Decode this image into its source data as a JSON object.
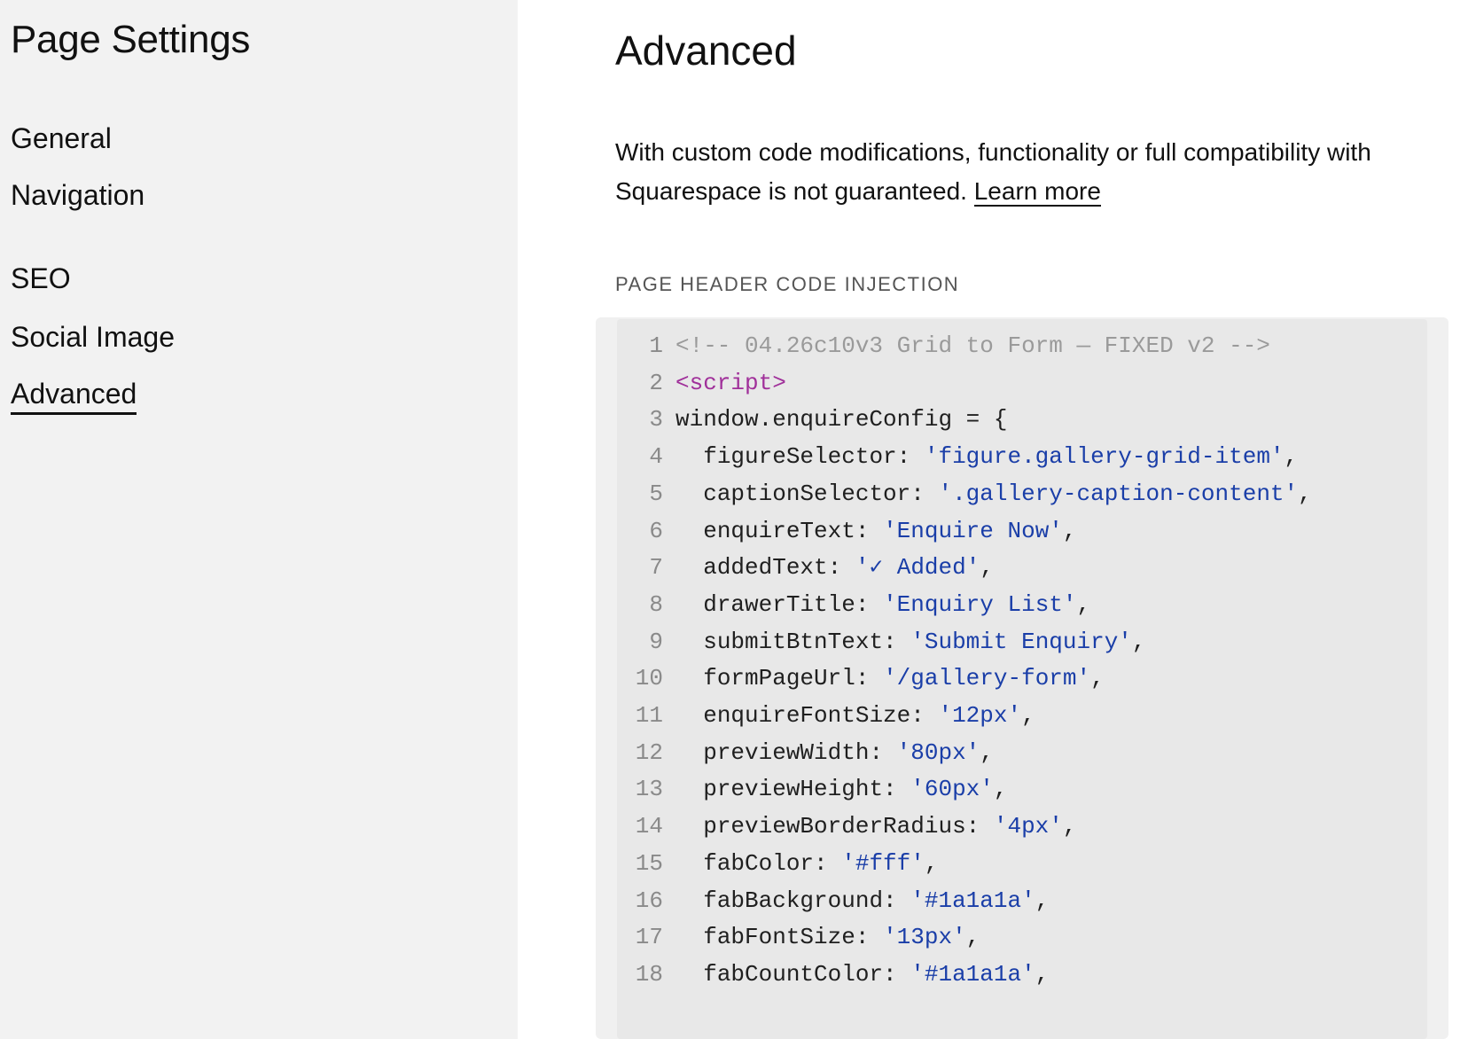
{
  "sidebar": {
    "title": "Page Settings",
    "items": [
      {
        "label": "General",
        "active": false
      },
      {
        "label": "Navigation",
        "active": false
      },
      {
        "label": "SEO",
        "active": false
      },
      {
        "label": "Social Image",
        "active": false
      },
      {
        "label": "Advanced",
        "active": true
      }
    ]
  },
  "main": {
    "title": "Advanced",
    "notice_text": "With custom code modifications, functionality or full compatibility with Squarespace is not guaranteed.",
    "learn_more_label": "Learn more",
    "section_label": "PAGE HEADER CODE INJECTION",
    "code_lines": [
      {
        "n": "1",
        "indent": "",
        "parts": [
          {
            "t": "comment",
            "v": "<!-- 04.26c10v3 Grid to Form — FIXED v2 -->"
          }
        ]
      },
      {
        "n": "2",
        "indent": "",
        "parts": [
          {
            "t": "tag",
            "v": "<script>"
          }
        ]
      },
      {
        "n": "3",
        "indent": "",
        "parts": [
          {
            "t": "plain",
            "v": "window.enquireConfig = {"
          }
        ]
      },
      {
        "n": "4",
        "indent": "  ",
        "parts": [
          {
            "t": "plain",
            "v": "figureSelector: "
          },
          {
            "t": "str",
            "v": "'figure.gallery-grid-item'"
          },
          {
            "t": "plain",
            "v": ","
          }
        ]
      },
      {
        "n": "5",
        "indent": "  ",
        "parts": [
          {
            "t": "plain",
            "v": "captionSelector: "
          },
          {
            "t": "str",
            "v": "'.gallery-caption-content'"
          },
          {
            "t": "plain",
            "v": ","
          }
        ]
      },
      {
        "n": "6",
        "indent": "  ",
        "parts": [
          {
            "t": "plain",
            "v": "enquireText: "
          },
          {
            "t": "str",
            "v": "'Enquire Now'"
          },
          {
            "t": "plain",
            "v": ","
          }
        ]
      },
      {
        "n": "7",
        "indent": "  ",
        "parts": [
          {
            "t": "plain",
            "v": "addedText: "
          },
          {
            "t": "str",
            "v": "'✓ Added'"
          },
          {
            "t": "plain",
            "v": ","
          }
        ]
      },
      {
        "n": "8",
        "indent": "  ",
        "parts": [
          {
            "t": "plain",
            "v": "drawerTitle: "
          },
          {
            "t": "str",
            "v": "'Enquiry List'"
          },
          {
            "t": "plain",
            "v": ","
          }
        ]
      },
      {
        "n": "9",
        "indent": "  ",
        "parts": [
          {
            "t": "plain",
            "v": "submitBtnText: "
          },
          {
            "t": "str",
            "v": "'Submit Enquiry'"
          },
          {
            "t": "plain",
            "v": ","
          }
        ]
      },
      {
        "n": "10",
        "indent": "  ",
        "parts": [
          {
            "t": "plain",
            "v": "formPageUrl: "
          },
          {
            "t": "str",
            "v": "'/gallery-form'"
          },
          {
            "t": "plain",
            "v": ","
          }
        ]
      },
      {
        "n": "11",
        "indent": "  ",
        "parts": [
          {
            "t": "plain",
            "v": "enquireFontSize: "
          },
          {
            "t": "str",
            "v": "'12px'"
          },
          {
            "t": "plain",
            "v": ","
          }
        ]
      },
      {
        "n": "12",
        "indent": "  ",
        "parts": [
          {
            "t": "plain",
            "v": "previewWidth: "
          },
          {
            "t": "str",
            "v": "'80px'"
          },
          {
            "t": "plain",
            "v": ","
          }
        ]
      },
      {
        "n": "13",
        "indent": "  ",
        "parts": [
          {
            "t": "plain",
            "v": "previewHeight: "
          },
          {
            "t": "str",
            "v": "'60px'"
          },
          {
            "t": "plain",
            "v": ","
          }
        ]
      },
      {
        "n": "14",
        "indent": "  ",
        "parts": [
          {
            "t": "plain",
            "v": "previewBorderRadius: "
          },
          {
            "t": "str",
            "v": "'4px'"
          },
          {
            "t": "plain",
            "v": ","
          }
        ]
      },
      {
        "n": "15",
        "indent": "  ",
        "parts": [
          {
            "t": "plain",
            "v": "fabColor: "
          },
          {
            "t": "str",
            "v": "'#fff'"
          },
          {
            "t": "plain",
            "v": ","
          }
        ]
      },
      {
        "n": "16",
        "indent": "  ",
        "parts": [
          {
            "t": "plain",
            "v": "fabBackground: "
          },
          {
            "t": "str",
            "v": "'#1a1a1a'"
          },
          {
            "t": "plain",
            "v": ","
          }
        ]
      },
      {
        "n": "17",
        "indent": "  ",
        "parts": [
          {
            "t": "plain",
            "v": "fabFontSize: "
          },
          {
            "t": "str",
            "v": "'13px'"
          },
          {
            "t": "plain",
            "v": ","
          }
        ]
      },
      {
        "n": "18",
        "indent": "  ",
        "parts": [
          {
            "t": "plain",
            "v": "fabCountColor: "
          },
          {
            "t": "str",
            "v": "'#1a1a1a'"
          },
          {
            "t": "plain",
            "v": ","
          }
        ]
      }
    ]
  },
  "colors": {
    "sidebar_bg": "#f2f2f2",
    "code_bg": "#e8e8e8",
    "code_comment": "#9a9a9a",
    "code_tag": "#a0309a",
    "code_string": "#1a3ea8"
  }
}
